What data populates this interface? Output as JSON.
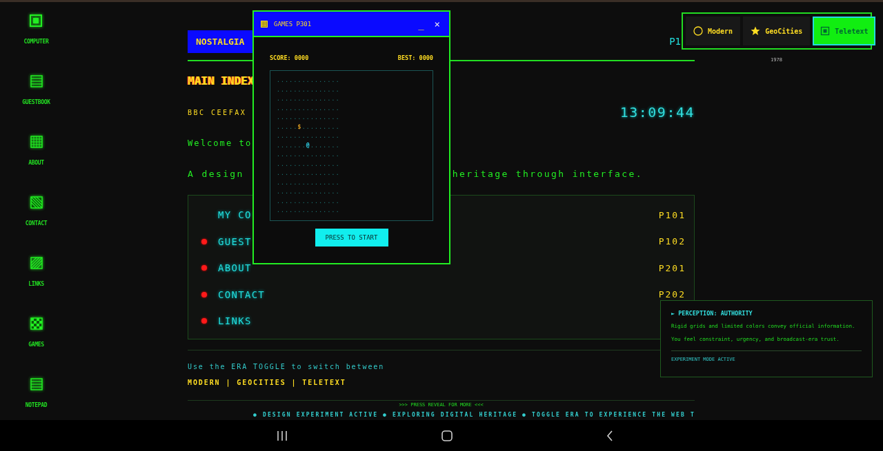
{
  "sidebar": {
    "items": [
      {
        "label": "COMPUTER"
      },
      {
        "label": "GUESTBOOK"
      },
      {
        "label": "ABOUT"
      },
      {
        "label": "CONTACT"
      },
      {
        "label": "LINKS"
      },
      {
        "label": "GAMES"
      },
      {
        "label": "NOTEPAD"
      }
    ]
  },
  "header": {
    "title": "NOSTALGIA",
    "page": "P1"
  },
  "heading": "MAIN INDEX",
  "service": "BBC CEEFAX",
  "clock": "13:09:44",
  "welcome": "Welcome to",
  "tagline": {
    "start": "A design",
    "end": "heritage through interface."
  },
  "menu": [
    {
      "label": "MY CO",
      "page": "P101",
      "bullet": false
    },
    {
      "label": "GUEST",
      "page": "P102",
      "bullet": true
    },
    {
      "label": "ABOUT",
      "page": "P201",
      "bullet": true
    },
    {
      "label": "CONTACT",
      "page": "P202",
      "bullet": true
    },
    {
      "label": "LINKS",
      "bullet": true
    }
  ],
  "footer": {
    "hint": "Use the ERA TOGGLE to switch between",
    "eras": "MODERN | GEOCITIES | TELETEXT",
    "reveal": ">>> PRESS REVEAL FOR MORE <<<",
    "ticker": "● DESIGN EXPERIMENT ACTIVE ● EXPLORING DIGITAL HERITAGE ● TOGGLE ERA TO EXPERIENCE THE WEB T"
  },
  "era_toggle": {
    "options": [
      {
        "label": "Modern",
        "selected": false
      },
      {
        "label": "GeoCities",
        "selected": false
      },
      {
        "label": "Teletext",
        "selected": true
      }
    ],
    "year": "1978"
  },
  "game_window": {
    "title": "GAMES P301",
    "minimize": "_",
    "close": "×",
    "score": "SCORE: 0000",
    "best": "BEST: 0000",
    "button": "PRESS TO START",
    "board": [
      [
        {
          "text": "...............",
          "kind": "empty"
        }
      ],
      [
        {
          "text": "...............",
          "kind": "empty"
        }
      ],
      [
        {
          "text": "...............",
          "kind": "empty"
        }
      ],
      [
        {
          "text": "...............",
          "kind": "empty"
        }
      ],
      [
        {
          "text": "...............",
          "kind": "empty"
        }
      ],
      [
        {
          "text": ".....",
          "kind": "empty"
        },
        {
          "text": "$",
          "kind": "food"
        },
        {
          "text": ".........",
          "kind": "empty"
        }
      ],
      [
        {
          "text": "...............",
          "kind": "empty"
        }
      ],
      [
        {
          "text": ".......",
          "kind": "empty"
        },
        {
          "text": "@",
          "kind": "player"
        },
        {
          "text": ".......",
          "kind": "empty"
        }
      ],
      [
        {
          "text": "...............",
          "kind": "empty"
        }
      ],
      [
        {
          "text": "...............",
          "kind": "empty"
        }
      ],
      [
        {
          "text": "...............",
          "kind": "empty"
        }
      ],
      [
        {
          "text": "...............",
          "kind": "empty"
        }
      ],
      [
        {
          "text": "...............",
          "kind": "empty"
        }
      ],
      [
        {
          "text": "...............",
          "kind": "empty"
        }
      ],
      [
        {
          "text": "...............",
          "kind": "empty"
        }
      ]
    ]
  },
  "info_panel": {
    "title": "► PERCEPTION: AUTHORITY",
    "lines": [
      "Rigid grids and limited colors convey official information.",
      "You feel constraint, urgency, and broadcast-era trust."
    ],
    "status": "EXPERIMENT MODE ACTIVE"
  }
}
